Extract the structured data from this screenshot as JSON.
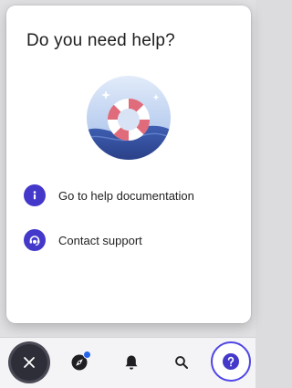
{
  "help_panel": {
    "title": "Do you need help?",
    "links": [
      {
        "label": "Go to help documentation",
        "icon": "info-icon"
      },
      {
        "label": "Contact support",
        "icon": "support-agent-icon"
      }
    ]
  },
  "bottom_nav": {
    "items": [
      {
        "name": "close",
        "icon": "close-icon"
      },
      {
        "name": "explore",
        "icon": "compass-icon",
        "has_notification": true
      },
      {
        "name": "notifications",
        "icon": "bell-icon"
      },
      {
        "name": "search",
        "icon": "search-icon"
      },
      {
        "name": "help",
        "icon": "help-icon",
        "active": true
      }
    ]
  },
  "colors": {
    "accent": "#4338ca",
    "active_ring": "#4f46e5",
    "close_button": "#2e2e39",
    "notification_dot": "#2563eb",
    "lifebuoy_red": "#e06b7a",
    "illustration_bg": "#bcd0ee"
  }
}
